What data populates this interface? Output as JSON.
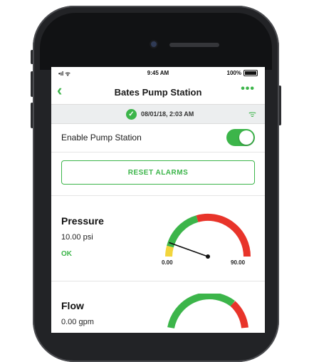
{
  "status_bar": {
    "signal": "•ıl ᯤ",
    "time": "9:45 AM",
    "battery": "100%"
  },
  "nav": {
    "back": "‹",
    "title": "Bates Pump Station",
    "more": "•••"
  },
  "info_bar": {
    "check_icon": "✓",
    "timestamp": "08/01/18, 2:03 AM",
    "wifi_icon": "ᯤ"
  },
  "enable": {
    "label": "Enable Pump Station",
    "on": true
  },
  "reset_label": "RESET ALARMS",
  "metrics": [
    {
      "name": "Pressure",
      "value": "10.00 psi",
      "status": "OK",
      "min": "0.00",
      "max": "90.00",
      "reading_fraction": 0.11
    },
    {
      "name": "Flow",
      "value": "0.00 gpm"
    }
  ],
  "colors": {
    "accent": "#3cb54a",
    "gauge_red": "#e8342a",
    "gauge_yellow": "#f2d53c",
    "gauge_green": "#3cb54a"
  }
}
